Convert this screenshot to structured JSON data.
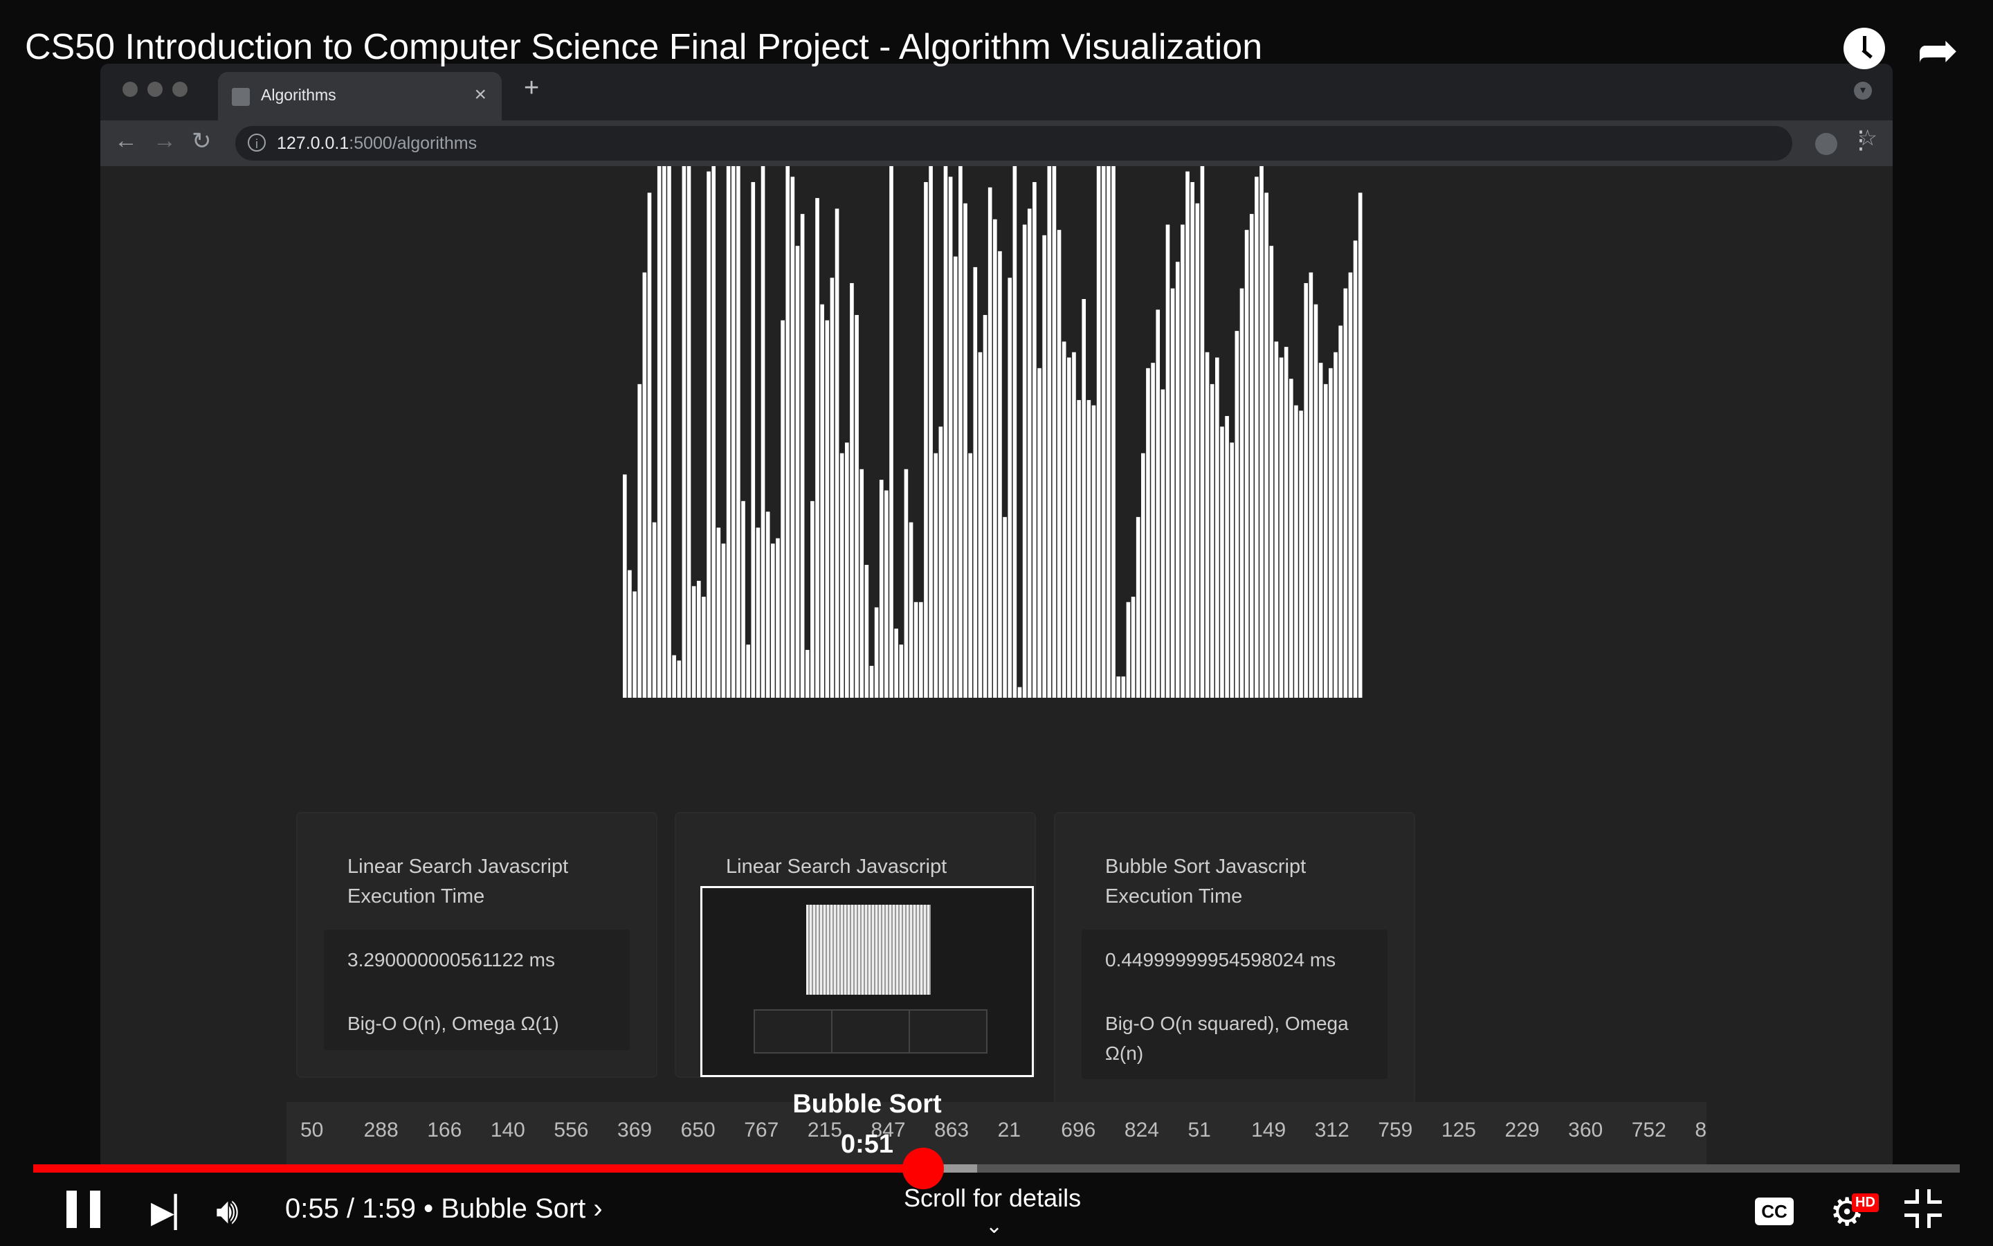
{
  "video": {
    "title": "CS50 Introduction to Computer Science Final Project - Algorithm Visualization",
    "current_time": "0:55",
    "duration": "1:59",
    "chapter": "Bubble Sort",
    "timecode_text": "0:55 / 1:59 • Bubble Sort ›",
    "progress_fraction": 0.462,
    "buffered_fraction": 0.49,
    "scroll_hint": "Scroll for details",
    "cc_label": "CC",
    "hd_badge": "HD",
    "preview": {
      "chapter": "Bubble Sort",
      "time": "0:51"
    },
    "icons": [
      "watch-later-icon",
      "share-icon",
      "pause-icon",
      "next-icon",
      "volume-icon",
      "captions-icon",
      "settings-icon",
      "exit-fullscreen-icon",
      "chevron-down-icon"
    ]
  },
  "browser": {
    "tab_title": "Algorithms",
    "url_host": "127.0.0.1",
    "url_rest": ":5000/algorithms"
  },
  "page": {
    "bar_values": [
      0.42,
      0.24,
      0.2,
      0.59,
      0.8,
      0.95,
      0.33,
      1,
      1,
      1,
      0.08,
      0.07,
      1,
      1,
      0.21,
      0.22,
      0.19,
      0.99,
      1,
      0.32,
      0.29,
      1,
      1,
      1,
      0.37,
      0.1,
      0.97,
      0.32,
      1,
      0.35,
      0.29,
      0.3,
      0.71,
      1,
      0.98,
      0.85,
      0.91,
      0.09,
      0.37,
      0.94,
      0.74,
      0.71,
      0.79,
      0.92,
      0.46,
      0.48,
      0.78,
      0.72,
      0.43,
      0.25,
      0.06,
      0.17,
      0.41,
      0.39,
      1,
      0.13,
      0.1,
      0.43,
      0.33,
      0.18,
      0.18,
      0.97,
      1,
      0.46,
      0.51,
      1,
      0.98,
      0.83,
      1,
      0.93,
      0.46,
      0.81,
      0.65,
      0.72,
      0.96,
      0.9,
      0.84,
      0.34,
      0.79,
      1,
      0.02,
      0.89,
      0.92,
      0.97,
      0.62,
      0.87,
      1,
      1,
      0.88,
      0.67,
      0.64,
      0.65,
      0.56,
      0.75,
      0.56,
      0.55,
      1,
      1,
      1,
      1,
      0.04,
      0.04,
      0.18,
      0.19,
      0.34,
      0.46,
      0.62,
      0.63,
      0.73,
      0.58,
      0.89,
      0.77,
      0.82,
      0.89,
      0.99,
      0.97,
      0.93,
      1,
      0.65,
      0.59,
      0.64,
      0.51,
      0.53,
      0.48,
      0.69,
      0.77,
      0.88,
      0.91,
      0.98,
      1,
      0.95,
      0.85,
      0.67,
      0.64,
      0.66,
      0.6,
      0.55,
      0.54,
      0.78,
      0.8,
      0.74,
      0.63,
      0.59,
      0.62,
      0.65,
      0.7,
      0.77,
      0.8,
      0.86,
      0.95
    ],
    "cards": [
      {
        "title": "Linear Search Javascript Execution Time",
        "time": "3.290000000561122 ms",
        "complexity": "Big-O O(n), Omega Ω(1)"
      },
      {
        "title": "Linear Search Javascript Execution Time",
        "time": "",
        "complexity": ""
      },
      {
        "title": "Bubble Sort Javascript Execution Time",
        "time": "0.44999999954598024 ms",
        "complexity": "Big-O O(n squared), Omega Ω(n)"
      }
    ],
    "numbers": [
      "50",
      "288",
      "166",
      "140",
      "556",
      "369",
      "650",
      "767",
      "215",
      "847",
      "863",
      "21",
      "696",
      "824",
      "51",
      "149",
      "312",
      "759",
      "125",
      "229",
      "360",
      "752",
      "8"
    ]
  }
}
